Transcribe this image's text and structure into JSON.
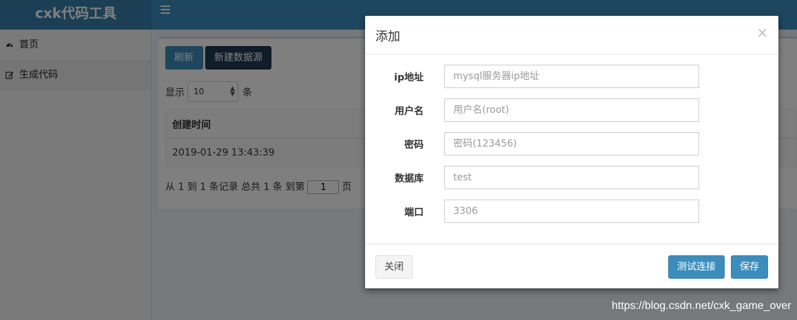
{
  "app": {
    "title": "cxk代码工具"
  },
  "sidebar": {
    "items": [
      {
        "label": "首页",
        "icon": "dashboard-icon"
      },
      {
        "label": "生成代码",
        "icon": "edit-icon"
      }
    ]
  },
  "toolbar": {
    "refresh_label": "刷新",
    "new_label": "新建数据源"
  },
  "length_menu": {
    "prefix": "显示",
    "value": "10",
    "suffix": "条"
  },
  "table": {
    "columns": [
      "创建时间"
    ],
    "rows": [
      [
        "2019-01-29 13:43:39"
      ]
    ]
  },
  "pager": {
    "info": "从 1 到 1 条记录 总共 1 条  到第",
    "page": "1",
    "suffix": "页"
  },
  "modal": {
    "title": "添加",
    "close_glyph": "×",
    "fields": [
      {
        "label": "ip地址",
        "placeholder": "mysql服务器ip地址",
        "value": ""
      },
      {
        "label": "用户名",
        "placeholder": "用户名(root)",
        "value": ""
      },
      {
        "label": "密码",
        "placeholder": "密码(123456)",
        "value": ""
      },
      {
        "label": "数据库",
        "placeholder": "test",
        "value": ""
      },
      {
        "label": "端口",
        "placeholder": "3306",
        "value": ""
      }
    ],
    "close_label": "关闭",
    "test_label": "测试连接",
    "save_label": "保存"
  },
  "watermark": "https://blog.csdn.net/cxk_game_over",
  "colors": {
    "header": "#3c8dbc",
    "logo_bg": "#367fa9",
    "primary": "#3c8dbc",
    "dark_button": "#1f3a57"
  }
}
